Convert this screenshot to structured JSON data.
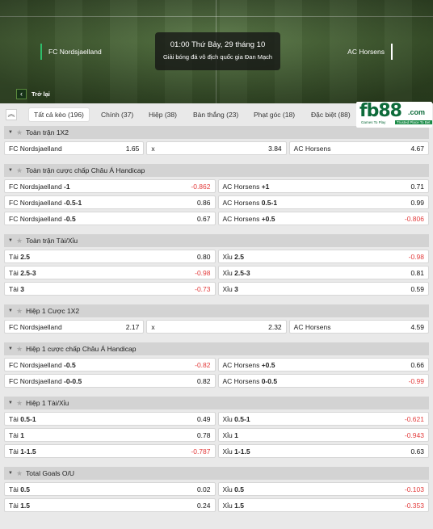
{
  "header": {
    "home_team": "FC Nordsjaelland",
    "away_team": "AC Horsens",
    "time": "01:00 Thứ Bảy, 29 tháng 10",
    "league": "Giải bóng đá vô địch quốc gia Đan Mạch",
    "back_label": "Trở lại"
  },
  "tabs": [
    {
      "label": "Tất cả kèo (196)",
      "active": true
    },
    {
      "label": "Chính (37)"
    },
    {
      "label": "Hiệp (38)"
    },
    {
      "label": "Bàn thắng (23)"
    },
    {
      "label": "Phạt góc (18)"
    },
    {
      "label": "Đặc biệt (88)"
    }
  ],
  "logo": {
    "brand": "fb88",
    "suffix": ".com",
    "tag1": "Games To Play",
    "tag2": "Trusted Place To Bet"
  },
  "sections": [
    {
      "title": "Toàn trận 1X2",
      "rows": [
        [
          {
            "label": "FC Nordsjaelland",
            "odd": "1.65"
          },
          {
            "label": "x",
            "odd": "3.84"
          },
          {
            "label": "AC Horsens",
            "odd": "4.67"
          }
        ]
      ]
    },
    {
      "title": "Toàn trận cược chấp Châu Á Handicap",
      "rows": [
        [
          {
            "label": "FC Nordsjaelland",
            "line": "-1",
            "odd": "-0.862"
          },
          {
            "label": "AC Horsens",
            "line": "+1",
            "odd": "0.71"
          }
        ],
        [
          {
            "label": "FC Nordsjaelland",
            "line": "-0.5-1",
            "odd": "0.86"
          },
          {
            "label": "AC Horsens",
            "line": "0.5-1",
            "odd": "0.99"
          }
        ],
        [
          {
            "label": "FC Nordsjaelland",
            "line": "-0.5",
            "odd": "0.67"
          },
          {
            "label": "AC Horsens",
            "line": "+0.5",
            "odd": "-0.806"
          }
        ]
      ]
    },
    {
      "title": "Toàn trận Tài/Xỉu",
      "rows": [
        [
          {
            "label": "Tài",
            "line": "2.5",
            "odd": "0.80"
          },
          {
            "label": "Xỉu",
            "line": "2.5",
            "odd": "-0.98"
          }
        ],
        [
          {
            "label": "Tài",
            "line": "2.5-3",
            "odd": "-0.98"
          },
          {
            "label": "Xỉu",
            "line": "2.5-3",
            "odd": "0.81"
          }
        ],
        [
          {
            "label": "Tài",
            "line": "3",
            "odd": "-0.73"
          },
          {
            "label": "Xỉu",
            "line": "3",
            "odd": "0.59"
          }
        ]
      ]
    },
    {
      "title": "Hiệp 1 Cược 1X2",
      "rows": [
        [
          {
            "label": "FC Nordsjaelland",
            "odd": "2.17"
          },
          {
            "label": "x",
            "odd": "2.32"
          },
          {
            "label": "AC Horsens",
            "odd": "4.59"
          }
        ]
      ]
    },
    {
      "title": "Hiệp 1 cược chấp Châu Á Handicap",
      "rows": [
        [
          {
            "label": "FC Nordsjaelland",
            "line": "-0.5",
            "odd": "-0.82"
          },
          {
            "label": "AC Horsens",
            "line": "+0.5",
            "odd": "0.66"
          }
        ],
        [
          {
            "label": "FC Nordsjaelland",
            "line": "-0-0.5",
            "odd": "0.82"
          },
          {
            "label": "AC Horsens",
            "line": "0-0.5",
            "odd": "-0.99"
          }
        ]
      ]
    },
    {
      "title": "Hiệp 1 Tài/Xỉu",
      "rows": [
        [
          {
            "label": "Tài",
            "line": "0.5-1",
            "odd": "0.49"
          },
          {
            "label": "Xỉu",
            "line": "0.5-1",
            "odd": "-0.621"
          }
        ],
        [
          {
            "label": "Tài",
            "line": "1",
            "odd": "0.78"
          },
          {
            "label": "Xỉu",
            "line": "1",
            "odd": "-0.943"
          }
        ],
        [
          {
            "label": "Tài",
            "line": "1-1.5",
            "odd": "-0.787"
          },
          {
            "label": "Xỉu",
            "line": "1-1.5",
            "odd": "0.63"
          }
        ]
      ]
    },
    {
      "title": "Total Goals O/U",
      "rows": [
        [
          {
            "label": "Tài",
            "line": "0.5",
            "odd": "0.02"
          },
          {
            "label": "Xỉu",
            "line": "0.5",
            "odd": "-0.103"
          }
        ],
        [
          {
            "label": "Tài",
            "line": "1.5",
            "odd": "0.24"
          },
          {
            "label": "Xỉu",
            "line": "1.5",
            "odd": "-0.353"
          }
        ]
      ]
    }
  ],
  "colors": {
    "negative": "#e23b3b",
    "accent": "#2fbd6b"
  },
  "icons": {
    "collapse": "double-chevron-up-icon",
    "section_toggle": "caret-down-icon",
    "favorite": "star-icon",
    "back": "chevron-left-icon"
  }
}
